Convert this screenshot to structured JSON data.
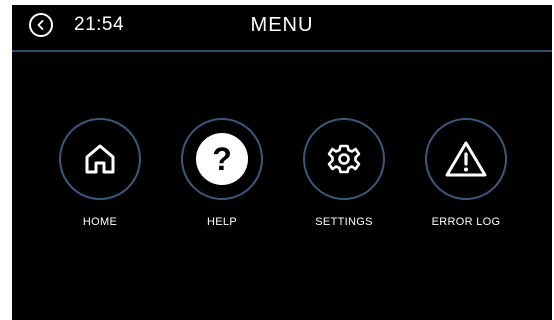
{
  "header": {
    "time": "21:54",
    "title": "MENU"
  },
  "menu": {
    "items": [
      {
        "label": "HOME",
        "icon": "home-icon"
      },
      {
        "label": "HELP",
        "icon": "help-icon"
      },
      {
        "label": "SETTINGS",
        "icon": "gear-icon"
      },
      {
        "label": "ERROR LOG",
        "icon": "warning-icon"
      }
    ]
  },
  "colors": {
    "background": "#000000",
    "ring": "#39597c",
    "divider": "#2f4d6e",
    "text": "#ffffff"
  }
}
